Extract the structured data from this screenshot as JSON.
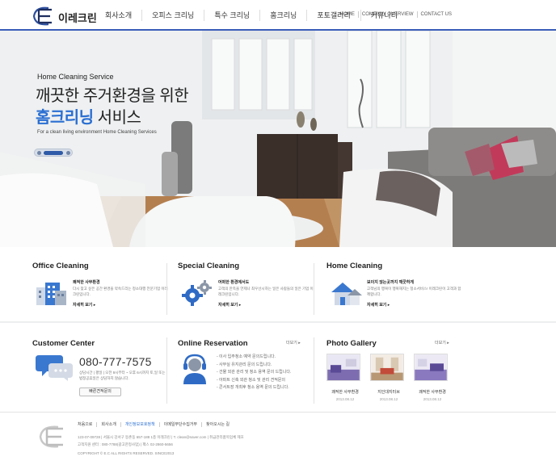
{
  "brand": {
    "name": "이레크린"
  },
  "nav": {
    "items": [
      "회사소개",
      "오피스 크리닝",
      "특수 크리닝",
      "홈크리닝",
      "포토갤러리",
      "커뮤니티"
    ]
  },
  "util": {
    "items": [
      "HOME",
      "COMPANY OVERVIEW",
      "CONTACT US"
    ]
  },
  "hero": {
    "subtitle": "Home Cleaning Service",
    "line1": "깨끗한 주거환경을 위한",
    "line2_highlight": "홈크리닝",
    "line2_rest": " 서비스",
    "english": "For a clean living environment Home Cleaning Services"
  },
  "services": [
    {
      "title": "Office Cleaning",
      "heading": "쾌적한 사무환경",
      "desc": "다시 찾고 싶은 공간 환경을 약속드리는 정소대행 전문기업 이레크린입니다.",
      "more": "자세히 보기 ▸",
      "icon": "office-building-icon"
    },
    {
      "title": "Special Cleaning",
      "heading": "어떠한 환경에서도",
      "desc": "고객의 만족을 언제나 최우선시하는 일은 사람들의 일은 기업 이레크린입니다.",
      "more": "자세히 보기 ▸",
      "icon": "gears-icon"
    },
    {
      "title": "Home Cleaning",
      "heading": "보이지 않는곳까지 깨끗하게",
      "desc": "고객님의 행복이 행복해지는 청소서비스! 이레크린이 고객과 함께합니다.",
      "more": "자세히 보기 ▸",
      "icon": "house-icon"
    }
  ],
  "customer": {
    "title": "Customer Center",
    "phone": "080-777-7575",
    "desc": "상담시간 | 평일 | 오전 9시부터 ~ 오후 6시까지 토,일 또는 법정공휴일은 상담하지 않습니다.",
    "button": "빠른견적문의"
  },
  "reservation": {
    "title": "Online Reservation",
    "more": "더보기 ▸",
    "items": [
      "- 이사 입주청소 예약 문의드립니다.",
      "- 사무실 유지관리 문의 드립니다.",
      "- 건물 외관 관리 및 청소 용역 문의 드립니다.",
      "- 아파트 신축 외관 청소 및 관리 견적문의",
      "- 콘서트장 개최후 청소 용역 문의 드립니다."
    ]
  },
  "gallery": {
    "title": "Photo Gallery",
    "more": "더보기 ▸",
    "items": [
      {
        "caption": "쾌적한 사무환경",
        "date": "2013.08.12"
      },
      {
        "caption": "지인대지터브",
        "date": "2013.08.12"
      },
      {
        "caption": "쾌적한 사무환경",
        "date": "2013.08.12"
      }
    ]
  },
  "footer": {
    "links": [
      "처음으로",
      "회사소개",
      "개인정보보호정책",
      "이메일무단수집거부",
      "찾아오시는 길"
    ],
    "line1": "123-07-09728 | 서울시 강서구 등촌동 657-188 1층 이레크린 | T. clean@naver.com | 취급관리품목업체 제호",
    "line2": "고객지원 센터 : 080-7788(광고한정사업) | 팩스 02-2860-5656",
    "copy": "COPYRIGHT © E.C ALL RIGHTS RESERVED. SINCE2013"
  },
  "colors": {
    "accent": "#2a6fd2",
    "nav_border": "#3a5db8"
  }
}
